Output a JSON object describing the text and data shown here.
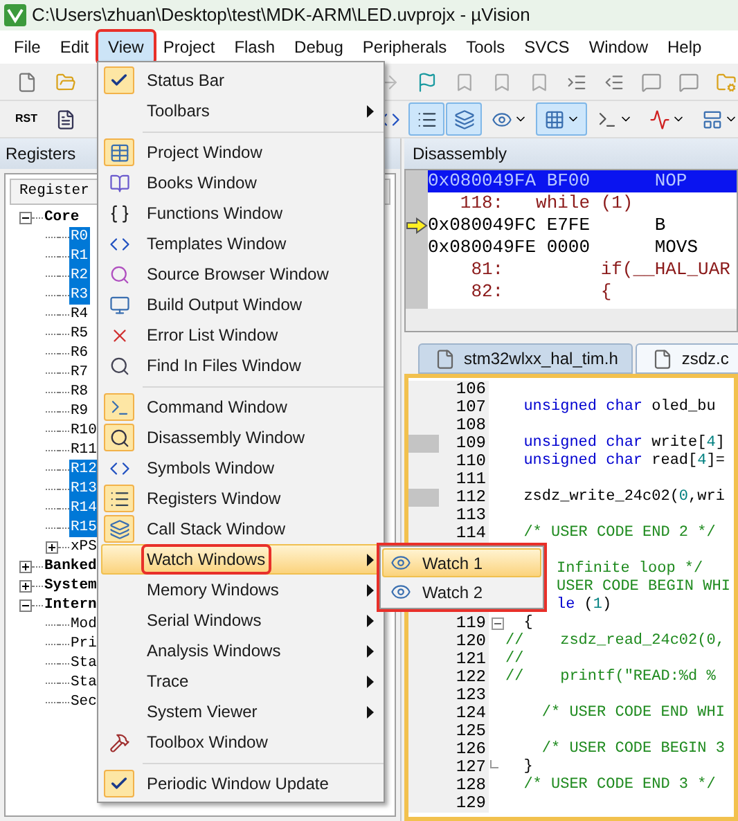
{
  "window": {
    "title": "C:\\Users\\zhuan\\Desktop\\test\\MDK-ARM\\LED.uvprojx - µVision"
  },
  "menu_bar": [
    {
      "label": "File",
      "selected": false,
      "annotated": false
    },
    {
      "label": "Edit",
      "selected": false,
      "annotated": false
    },
    {
      "label": "View",
      "selected": true,
      "annotated": true
    },
    {
      "label": "Project",
      "selected": false,
      "annotated": false
    },
    {
      "label": "Flash",
      "selected": false,
      "annotated": false
    },
    {
      "label": "Debug",
      "selected": false,
      "annotated": false
    },
    {
      "label": "Peripherals",
      "selected": false,
      "annotated": false
    },
    {
      "label": "Tools",
      "selected": false,
      "annotated": false
    },
    {
      "label": "SVCS",
      "selected": false,
      "annotated": false
    },
    {
      "label": "Window",
      "selected": false,
      "annotated": false
    },
    {
      "label": "Help",
      "selected": false,
      "annotated": false
    }
  ],
  "toolbar_1": {
    "left_buttons": [
      {
        "selected": false
      },
      {
        "selected": false
      }
    ],
    "right_buttons": [
      {
        "selected": false
      },
      {
        "selected": false
      },
      {
        "selected": false
      },
      {
        "selected": false
      },
      {
        "selected": false
      },
      {
        "selected": false
      },
      {
        "selected": false
      },
      {
        "selected": false
      },
      {
        "selected": false
      },
      {
        "selected": false
      }
    ]
  },
  "toolbar_2": {
    "left_buttons": [
      {
        "text": "RST",
        "selected": false
      },
      {
        "selected": false
      }
    ],
    "right_buttons": [
      {
        "selected": false
      },
      {
        "selected": true
      },
      {
        "selected": true
      },
      {
        "selected": false,
        "dropdown": true
      },
      {
        "selected": true,
        "dropdown": true
      },
      {
        "selected": false,
        "dropdown": true
      },
      {
        "selected": false,
        "dropdown": true
      },
      {
        "selected": false,
        "dropdown": true
      }
    ]
  },
  "registers_panel": {
    "title": "Registers",
    "column": "Register",
    "tree": [
      {
        "label": "Core",
        "expanded": true,
        "selected": false,
        "children": [
          {
            "label": "R0",
            "selected": true
          },
          {
            "label": "R1",
            "selected": true
          },
          {
            "label": "R2",
            "selected": true
          },
          {
            "label": "R3",
            "selected": true
          },
          {
            "label": "R4",
            "selected": false
          },
          {
            "label": "R5",
            "selected": false
          },
          {
            "label": "R6",
            "selected": false
          },
          {
            "label": "R7",
            "selected": false
          },
          {
            "label": "R8",
            "selected": false
          },
          {
            "label": "R9",
            "selected": false
          },
          {
            "label": "R10",
            "selected": false
          },
          {
            "label": "R11",
            "selected": false
          },
          {
            "label": "R12",
            "selected": true
          },
          {
            "label": "R13",
            "selected": true
          },
          {
            "label": "R14",
            "selected": true
          },
          {
            "label": "R15",
            "selected": true
          },
          {
            "label": "xPS",
            "expanded": false,
            "selected": false
          }
        ]
      },
      {
        "label": "Banked",
        "expanded": false,
        "selected": false
      },
      {
        "label": "System",
        "expanded": false,
        "selected": false
      },
      {
        "label": "Intern",
        "expanded": true,
        "selected": false,
        "children": [
          {
            "label": "Mod",
            "selected": false
          },
          {
            "label": "Pri",
            "selected": false
          },
          {
            "label": "Sta",
            "selected": false
          },
          {
            "label": "Sta",
            "selected": false
          },
          {
            "label": "Sec",
            "selected": false
          }
        ]
      }
    ]
  },
  "disassembly_panel": {
    "title": "Disassembly",
    "rows": [
      {
        "kind": "asm",
        "text": "0x080049FA BF00      NOP",
        "selected": true,
        "current": false
      },
      {
        "kind": "source",
        "text": "   118:   while (1)",
        "selected": false,
        "current": false
      },
      {
        "kind": "asm",
        "text": "0x080049FC E7FE      B",
        "selected": false,
        "current": true
      },
      {
        "kind": "asm",
        "text": "0x080049FE 0000      MOVS",
        "selected": false,
        "current": false
      },
      {
        "kind": "source",
        "text": "    81:         if(__HAL_UAR",
        "selected": false,
        "current": false
      },
      {
        "kind": "source",
        "text": "    82:         {",
        "selected": false,
        "current": false
      }
    ]
  },
  "editor": {
    "tabs": [
      {
        "label": "stm32wlxx_hal_tim.h",
        "selected": false
      },
      {
        "label": "zsdz.c",
        "selected": true
      }
    ],
    "lines": [
      {
        "number": "106",
        "kind": "full"
      },
      {
        "number": "107",
        "kind": "full",
        "segments": [
          {
            "kind": "keyword",
            "text": "  unsigned char"
          },
          {
            "kind": "plain",
            "text": " oled_bu"
          }
        ]
      },
      {
        "number": "108",
        "kind": "full"
      },
      {
        "number": "109",
        "kind": "full",
        "marked": true,
        "segments": [
          {
            "kind": "keyword",
            "text": "  unsigned char"
          },
          {
            "kind": "plain",
            "text": " write["
          },
          {
            "kind": "number",
            "text": "4"
          },
          {
            "kind": "plain",
            "text": "]"
          }
        ]
      },
      {
        "number": "110",
        "kind": "full",
        "segments": [
          {
            "kind": "keyword",
            "text": "  unsigned char"
          },
          {
            "kind": "plain",
            "text": " read["
          },
          {
            "kind": "number",
            "text": "4"
          },
          {
            "kind": "plain",
            "text": "]="
          }
        ]
      },
      {
        "number": "111",
        "kind": "full"
      },
      {
        "number": "112",
        "kind": "full",
        "marked": true,
        "segments": [
          {
            "kind": "plain",
            "text": "  zsdz_write_24c02("
          },
          {
            "kind": "number",
            "text": "0"
          },
          {
            "kind": "plain",
            "text": ",wri"
          }
        ]
      },
      {
        "number": "113",
        "kind": "full"
      },
      {
        "number": "114",
        "kind": "full",
        "segments": [
          {
            "kind": "comment",
            "text": "  /* USER CODE END 2 */"
          }
        ]
      },
      {
        "kind": "partial"
      },
      {
        "kind": "partial",
        "segments": [
          {
            "kind": "comment",
            "text": "Infinite loop */"
          }
        ]
      },
      {
        "kind": "partial",
        "segments": [
          {
            "kind": "comment",
            "text": "USER CODE BEGIN WHI"
          }
        ]
      },
      {
        "kind": "partial",
        "segments": [
          {
            "kind": "keyword",
            "text": "le"
          },
          {
            "kind": "plain",
            "text": " ("
          },
          {
            "kind": "number",
            "text": "1"
          },
          {
            "kind": "plain",
            "text": ")"
          }
        ]
      },
      {
        "number": "119",
        "kind": "full",
        "fold_start": true,
        "segments": [
          {
            "kind": "plain",
            "text": "  {"
          }
        ]
      },
      {
        "number": "120",
        "kind": "full",
        "segments": [
          {
            "kind": "comment",
            "text": "//    zsdz_read_24c02(0,"
          }
        ]
      },
      {
        "number": "121",
        "kind": "full",
        "segments": [
          {
            "kind": "comment",
            "text": "//"
          }
        ]
      },
      {
        "number": "122",
        "kind": "full",
        "segments": [
          {
            "kind": "comment",
            "text": "//    printf(\"READ:%d %"
          }
        ]
      },
      {
        "number": "123",
        "kind": "full"
      },
      {
        "number": "124",
        "kind": "full",
        "segments": [
          {
            "kind": "comment",
            "text": "    /* USER CODE END WHI"
          }
        ]
      },
      {
        "number": "125",
        "kind": "full"
      },
      {
        "number": "126",
        "kind": "full",
        "segments": [
          {
            "kind": "comment",
            "text": "    /* USER CODE BEGIN 3"
          }
        ]
      },
      {
        "number": "127",
        "kind": "full",
        "fold_end": true,
        "segments": [
          {
            "kind": "plain",
            "text": "  }"
          }
        ]
      },
      {
        "number": "128",
        "kind": "full",
        "segments": [
          {
            "kind": "comment",
            "text": "  /* USER CODE END 3 */"
          }
        ]
      },
      {
        "number": "129",
        "kind": "full"
      }
    ]
  },
  "view_menu": {
    "items": [
      {
        "kind": "check",
        "label": "Status Bar",
        "checked": true
      },
      {
        "kind": "submenu",
        "label": "Toolbars",
        "selected": false,
        "annotated": false
      },
      {
        "kind": "separator"
      },
      {
        "kind": "window",
        "label": "Project Window",
        "on": true
      },
      {
        "kind": "window",
        "label": "Books Window",
        "on": false
      },
      {
        "kind": "window",
        "label": "Functions Window",
        "on": false
      },
      {
        "kind": "window",
        "label": "Templates Window",
        "on": false
      },
      {
        "kind": "window",
        "label": "Source Browser Window",
        "on": false
      },
      {
        "kind": "window",
        "label": "Build Output Window",
        "on": false
      },
      {
        "kind": "window",
        "label": "Error List Window",
        "on": false
      },
      {
        "kind": "window",
        "label": "Find In Files Window",
        "on": false
      },
      {
        "kind": "separator"
      },
      {
        "kind": "window",
        "label": "Command Window",
        "on": true
      },
      {
        "kind": "window",
        "label": "Disassembly Window",
        "on": true
      },
      {
        "kind": "window",
        "label": "Symbols Window",
        "on": false
      },
      {
        "kind": "window",
        "label": "Registers Window",
        "on": true
      },
      {
        "kind": "window",
        "label": "Call Stack Window",
        "on": true
      },
      {
        "kind": "submenu",
        "label": "Watch Windows",
        "selected": true,
        "annotated": true
      },
      {
        "kind": "submenu",
        "label": "Memory Windows",
        "selected": false,
        "annotated": false
      },
      {
        "kind": "submenu",
        "label": "Serial Windows",
        "selected": false,
        "annotated": false
      },
      {
        "kind": "submenu",
        "label": "Analysis Windows",
        "selected": false,
        "annotated": false
      },
      {
        "kind": "submenu",
        "label": "Trace",
        "selected": false,
        "annotated": false
      },
      {
        "kind": "submenu",
        "label": "System Viewer",
        "selected": false,
        "annotated": false
      },
      {
        "kind": "window",
        "label": "Toolbox Window",
        "on": false
      },
      {
        "kind": "separator"
      },
      {
        "kind": "check",
        "label": "Periodic Window Update",
        "checked": true
      }
    ]
  },
  "watch_submenu": {
    "annotated": true,
    "items": [
      {
        "label": "Watch 1",
        "selected": true
      },
      {
        "label": "Watch 2",
        "selected": false
      }
    ]
  }
}
